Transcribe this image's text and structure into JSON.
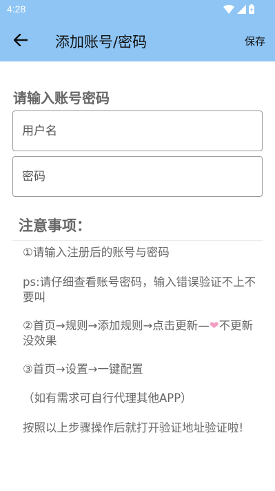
{
  "status_bar": {
    "time": "4:28"
  },
  "app_bar": {
    "title": "添加账号/密码",
    "save_label": "保存",
    "bg_color": "#8ec5f4"
  },
  "form": {
    "section_title": "请输入账号密码",
    "username_placeholder": "用户名",
    "password_placeholder": "密码"
  },
  "notes": {
    "title": "注意事项：",
    "items": [
      "①请输入注册后的账号与密码",
      "ps:请仔细查看账号密码，输入错误验证不上不要叫",
      "②首页→规则→添加规则→点击更新—",
      "不更新没效果",
      "③首页→设置→一键配置",
      "（如有需求可自行代理其他APP）",
      "按照以上步骤操作后就打开验证地址验证啦!"
    ],
    "heart_color": "#f19ec2"
  }
}
